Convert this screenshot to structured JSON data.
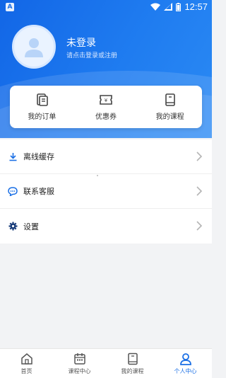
{
  "status_bar": {
    "time": "12:57",
    "app_badge": "A"
  },
  "profile": {
    "name": "未登录",
    "hint": "请点击登录或注册"
  },
  "quick_actions": [
    {
      "label": "我的订单",
      "icon": "orders-icon"
    },
    {
      "label": "优惠券",
      "icon": "coupon-icon"
    },
    {
      "label": "我的课程",
      "icon": "course-book-icon"
    }
  ],
  "menu": [
    {
      "label": "离线缓存",
      "icon": "download-icon"
    },
    {
      "label": "联系客服",
      "icon": "chat-icon"
    },
    {
      "label": "设置",
      "icon": "gear-icon"
    }
  ],
  "bottom_nav": [
    {
      "label": "首页",
      "icon": "home-icon",
      "active": false
    },
    {
      "label": "课程中心",
      "icon": "calendar-icon",
      "active": false
    },
    {
      "label": "我的课程",
      "icon": "book-icon",
      "active": false
    },
    {
      "label": "个人中心",
      "icon": "person-icon",
      "active": true
    }
  ],
  "colors": {
    "primary": "#1a6fe5",
    "header_start": "#1266e6",
    "header_end": "#2b8af4"
  }
}
